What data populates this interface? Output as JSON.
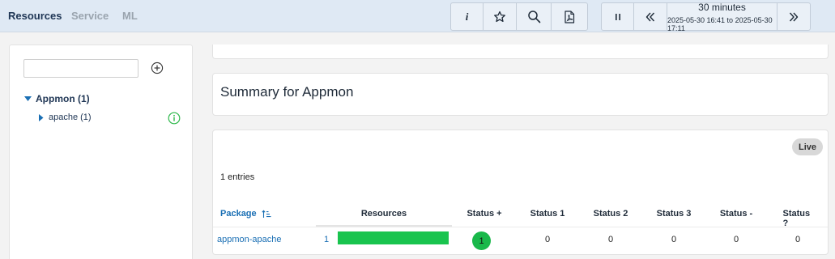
{
  "nav": {
    "tabs": [
      "Resources",
      "Service",
      "ML"
    ],
    "active": "Resources"
  },
  "toolbar": {
    "info_label": "i",
    "icons": [
      "info-icon",
      "star-icon",
      "search-icon",
      "pdf-icon",
      "pause-icon",
      "chevron-double-left-icon",
      "chevron-double-right-icon"
    ],
    "time_main": "30 minutes",
    "time_range": "2025-05-30 16:41 to 2025-05-30 17:11"
  },
  "sidebar": {
    "filter_value": "",
    "tree": {
      "label": "Appmon (1)",
      "children": [
        {
          "label": "apache (1)",
          "status": "ok"
        }
      ]
    }
  },
  "summary": {
    "title": "Summary for Appmon"
  },
  "table": {
    "live_label": "Live",
    "entries_text": "1 entries",
    "headers": {
      "package": "Package",
      "resources": "Resources",
      "status_plus": "Status +",
      "status_1": "Status 1",
      "status_2": "Status 2",
      "status_3": "Status 3",
      "status_minus": "Status -",
      "status_q": "Status ?"
    },
    "rows": [
      {
        "package": "appmon-apache",
        "resources": "1",
        "resources_fill": 1.0,
        "status_plus": "1",
        "status_1": "0",
        "status_2": "0",
        "status_3": "0",
        "status_minus": "0",
        "status_q": "0"
      }
    ]
  },
  "colors": {
    "topbar_bg": "#dfe9f4",
    "nav_active": "#1e3554",
    "link": "#1a6fb4",
    "ok_green": "#19c44e",
    "info_green": "#2db84a"
  }
}
